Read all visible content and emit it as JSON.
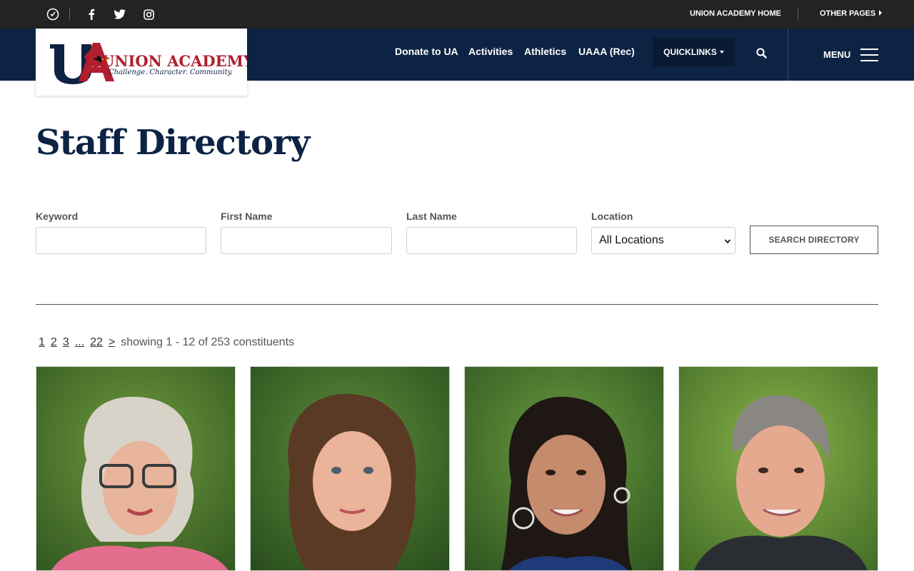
{
  "utility": {
    "home_link": "UNION ACADEMY HOME",
    "other_pages": "OTHER PAGES",
    "social": [
      "apps-icon",
      "facebook-icon",
      "twitter-icon",
      "instagram-icon"
    ]
  },
  "logo": {
    "monogram": "UA",
    "name": "UNION ACADEMY",
    "tagline": "Challenge. Character. Community."
  },
  "nav": {
    "items": [
      "Donate to UA",
      "Activities",
      "Athletics",
      "UAAA (Rec)"
    ],
    "quicklinks": "QUICKLINKS",
    "menu": "MENU"
  },
  "page": {
    "title": "Staff Directory"
  },
  "form": {
    "keyword_label": "Keyword",
    "first_name_label": "First Name",
    "last_name_label": "Last Name",
    "location_label": "Location",
    "location_value": "All Locations",
    "keyword_value": "",
    "first_name_value": "",
    "last_name_value": "",
    "search_button": "SEARCH DIRECTORY"
  },
  "pagination": {
    "pages": [
      "1",
      "2",
      "3",
      "...",
      "22",
      ">"
    ],
    "summary": "showing 1 - 12 of 253 constituents"
  },
  "colors": {
    "navy": "#0d2343",
    "utility_bar": "#232323",
    "brand_red": "#b01e2f"
  }
}
